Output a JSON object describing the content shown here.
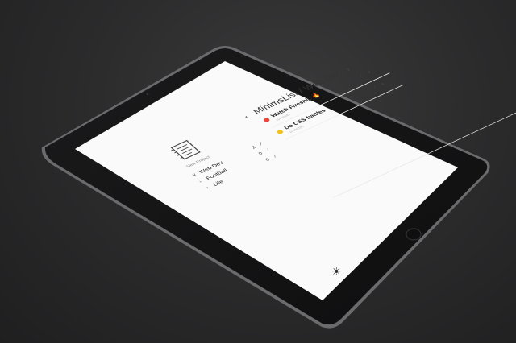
{
  "app": {
    "title": "MinimsList / Web Dev",
    "new_project_label": "New Project"
  },
  "projects": [
    {
      "caret": "∨",
      "name": "Web Dev",
      "count": "2"
    },
    {
      "caret": "›",
      "name": "Football",
      "count": "0"
    },
    {
      "caret": "›",
      "name": "Life",
      "count": "0"
    }
  ],
  "tasks": [
    {
      "name": "Watch Fireship 🔥",
      "subtitle": "11/06/2020",
      "color": "#e8473c"
    },
    {
      "name": "Do CSS battles",
      "subtitle": "11/06/2020",
      "color": "#f2c21b"
    }
  ],
  "icons": {
    "back": "‹",
    "edit": "∕",
    "expand": "∨",
    "add": "⊕",
    "theme": "☀"
  }
}
